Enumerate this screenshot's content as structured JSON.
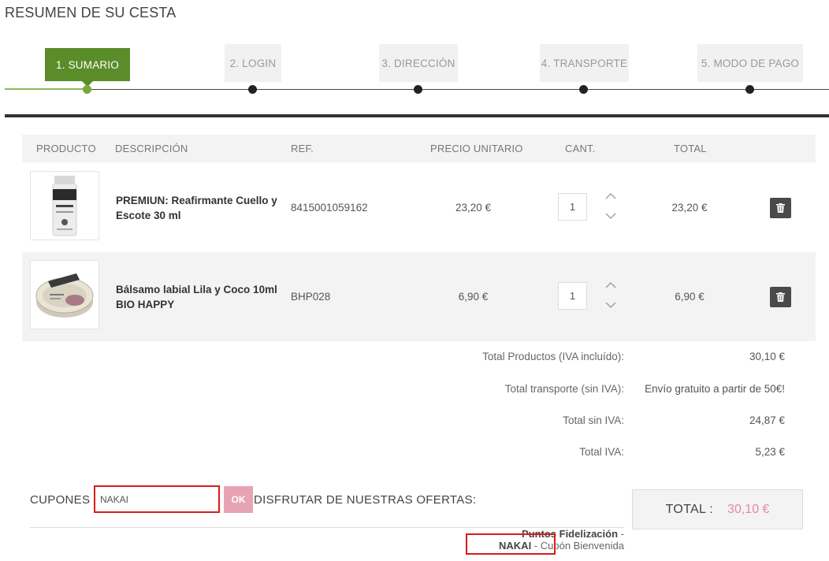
{
  "page": {
    "title": "RESUMEN DE SU CESTA"
  },
  "steps": [
    {
      "label": "1. SUMARIO"
    },
    {
      "label": "2. LOGIN"
    },
    {
      "label": "3. DIRECCIÓN"
    },
    {
      "label": "4. TRANSPORTE"
    },
    {
      "label": "5. MODO DE PAGO"
    }
  ],
  "table": {
    "headers": {
      "product": "PRODUCTO",
      "description": "DESCRIPCIÓN",
      "ref": "REF.",
      "unit_price": "PRECIO UNITARIO",
      "qty": "CANT.",
      "total": "TOTAL"
    },
    "rows": [
      {
        "description": "PREMIUN: Reafirmante Cuello y Escote 30 ml",
        "ref": "8415001059162",
        "unit_price": "23,20 €",
        "qty": "1",
        "total": "23,20 €"
      },
      {
        "description": "Bálsamo labial Lila y Coco 10ml BIO HAPPY",
        "ref": "BHP028",
        "unit_price": "6,90 €",
        "qty": "1",
        "total": "6,90 €"
      }
    ]
  },
  "summary": {
    "products_label": "Total Productos (IVA incluído):",
    "products_value": "30,10 €",
    "shipping_label": "Total transporte (sin IVA):",
    "shipping_value": "Envío gratuito a partir de 50€!",
    "no_tax_label": "Total sin IVA:",
    "no_tax_value": "24,87 €",
    "tax_label": "Total IVA:",
    "tax_value": "5,23 €"
  },
  "coupons": {
    "label": "CUPONES",
    "input_value": "NAKAI",
    "ok_label": "OK",
    "offers_label": "DISFRUTAR DE NUESTRAS OFERTAS:",
    "offers": [
      {
        "name": "Puntos Fidelización",
        "suffix": " -"
      },
      {
        "name": "NAKAI",
        "suffix": " - Cupón Bienvenida"
      }
    ]
  },
  "total_box": {
    "label": "TOTAL :",
    "value": "30,10 €"
  },
  "colors": {
    "step_active": "#5b8c2a",
    "step_done_line": "#8cb85c",
    "total_value": "#e8899f",
    "ok_button": "#e8a3b3",
    "highlight": "#d91c1c"
  }
}
